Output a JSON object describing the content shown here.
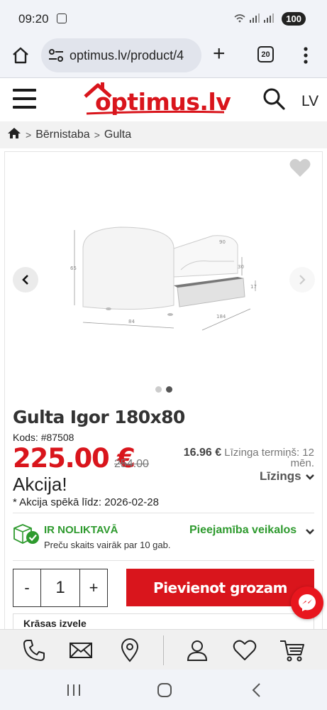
{
  "status_bar": {
    "time": "09:20",
    "battery": "100",
    "screenshot_icon": "screenshot-icon",
    "signal_icons": "wifi-signal-icons"
  },
  "browser": {
    "url": "optimus.lv/product/4",
    "tab_count": "20",
    "icons": [
      "home-icon",
      "site-settings-icon",
      "new-tab-icon",
      "tab-switcher-icon",
      "menu-icon"
    ]
  },
  "site_header": {
    "logo_text": "optimus.lv",
    "language": "LV",
    "brand_color": "#d9151c"
  },
  "breadcrumb": {
    "items": [
      "Bērnistaba",
      "Gulta"
    ]
  },
  "gallery": {
    "image_count": 2,
    "active_index": 1
  },
  "product": {
    "title": "Gulta Igor 180x80",
    "code": "Kods: #87508",
    "price": "225.00 €",
    "old_price": "254.00",
    "lease_amount": "16.96 €",
    "lease_text": "Līzinga termiņš: 12 mēn.",
    "leasing_label": "Līzings",
    "promo": "Akcija!",
    "promo_note": "* Akcija spēkā līdz: 2026-02-28",
    "stock_title": "IR NOLIKTAVĀ",
    "stock_subtitle": "Preču skaits vairāk par 10 gab.",
    "store_availability": "Pieejamība veikalos",
    "quantity": "1",
    "minus_label": "-",
    "plus_label": "+",
    "add_to_cart": "Pievienot grozam",
    "color_section": "Krāsas izvele"
  },
  "colors": {
    "green": "#2e9a2e",
    "red": "#d9151c"
  },
  "bottom_bar": {
    "icons": [
      "phone-icon",
      "mail-icon",
      "location-icon",
      "account-icon",
      "wishlist-icon",
      "cart-icon"
    ]
  },
  "android_nav": {
    "icons": [
      "recents-icon",
      "home-nav-icon",
      "back-icon"
    ]
  }
}
